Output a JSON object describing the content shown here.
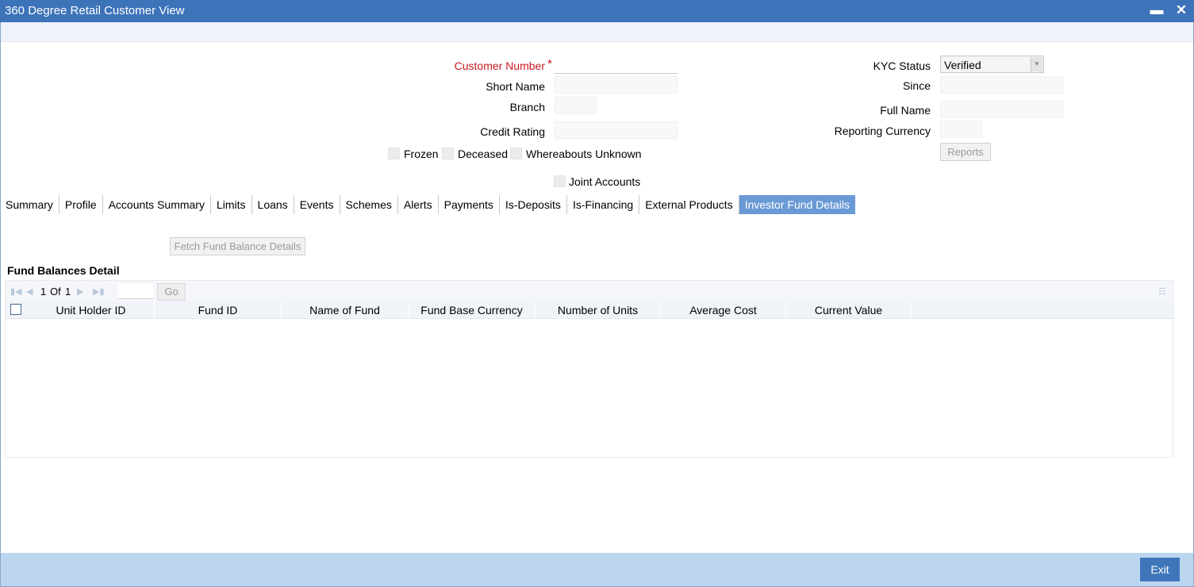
{
  "window": {
    "title": "360 Degree Retail Customer View",
    "minimize_glyph": "▬",
    "close_glyph": "✕"
  },
  "form": {
    "customer_number_label": "Customer Number",
    "required_mark": "*",
    "short_name_label": "Short Name",
    "branch_label": "Branch",
    "credit_rating_label": "Credit Rating",
    "kyc_status_label": "KYC Status",
    "kyc_status_value": "Verified",
    "since_label": "Since",
    "full_name_label": "Full Name",
    "reporting_currency_label": "Reporting Currency",
    "reports_button": "Reports",
    "frozen_label": "Frozen",
    "deceased_label": "Deceased",
    "whereabouts_label": "Whereabouts Unknown",
    "joint_accounts_label": "Joint Accounts",
    "customer_number_value": "",
    "short_name_value": "",
    "branch_value": "",
    "credit_rating_value": "",
    "since_value": "",
    "full_name_value": "",
    "reporting_currency_value": ""
  },
  "tabs": [
    {
      "label": "Summary",
      "active": false
    },
    {
      "label": "Profile",
      "active": false
    },
    {
      "label": "Accounts Summary",
      "active": false
    },
    {
      "label": "Limits",
      "active": false
    },
    {
      "label": "Loans",
      "active": false
    },
    {
      "label": "Events",
      "active": false
    },
    {
      "label": "Schemes",
      "active": false
    },
    {
      "label": "Alerts",
      "active": false
    },
    {
      "label": "Payments",
      "active": false
    },
    {
      "label": "Is-Deposits",
      "active": false
    },
    {
      "label": "Is-Financing",
      "active": false
    },
    {
      "label": "External Products",
      "active": false
    },
    {
      "label": "Investor Fund Details",
      "active": true
    }
  ],
  "fund_panel": {
    "fetch_button": "Fetch Fund Balance Details",
    "section_title": "Fund Balances Detail",
    "pager": {
      "current": "1",
      "of_label": "Of",
      "total": "1",
      "go_label": "Go"
    },
    "columns": [
      "Unit Holder ID",
      "Fund ID",
      "Name of Fund",
      "Fund Base Currency",
      "Number of Units",
      "Average Cost",
      "Current Value"
    ],
    "rows": []
  },
  "footer": {
    "exit_label": "Exit"
  },
  "colors": {
    "titlebar": "#3d73b9",
    "active_tab": "#6a9ad6",
    "footer": "#bcd5ee",
    "exit_button": "#3f76ba",
    "required": "#c8191f"
  }
}
